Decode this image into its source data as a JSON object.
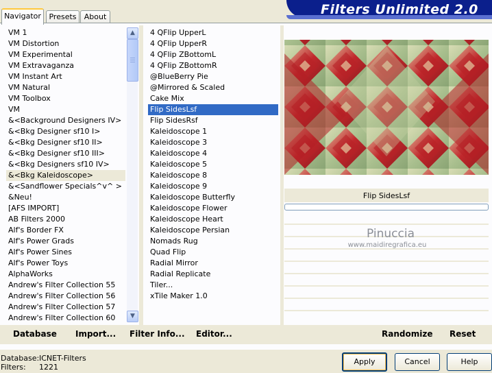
{
  "tabs": [
    "Navigator",
    "Presets",
    "About"
  ],
  "title": "Filters Unlimited 2.0",
  "categories": [
    "VM 1",
    "VM Distortion",
    "VM Experimental",
    "VM Extravaganza",
    "VM Instant Art",
    "VM Natural",
    "VM Toolbox",
    "VM",
    "&<Background Designers IV>",
    "&<Bkg Designer sf10 I>",
    "&<Bkg Designer sf10 II>",
    "&<Bkg Designer sf10 III>",
    "&<Bkg Designers sf10 IV>",
    "&<Bkg Kaleidoscope>",
    "&<Sandflower Specials^v^ >",
    "&Neu!",
    "[AFS IMPORT]",
    "AB Filters 2000",
    "Alf's Border FX",
    "Alf's Power Grads",
    "Alf's Power Sines",
    "Alf's Power Toys",
    "AlphaWorks",
    "Andrew's Filter Collection 55",
    "Andrew's Filter Collection 56",
    "Andrew's Filter Collection 57",
    "Andrew's Filter Collection 60"
  ],
  "selected_category": "&<Bkg Kaleidoscope>",
  "filters": [
    "4 QFlip UpperL",
    "4 QFlip UpperR",
    "4 QFlip ZBottomL",
    "4 QFlip ZBottomR",
    "@BlueBerry Pie",
    "@Mirrored & Scaled",
    "Cake Mix",
    "Flip SidesLsf",
    "Flip SidesRsf",
    "Kaleidoscope 1",
    "Kaleidoscope 3",
    "Kaleidoscope 4",
    "Kaleidoscope 5",
    "Kaleidoscope 8",
    "Kaleidoscope 9",
    "Kaleidoscope Butterfly",
    "Kaleidoscope Flower",
    "Kaleidoscope Heart",
    "Kaleidoscope Persian",
    "Nomads Rug",
    "Quad Flip",
    "Radial Mirror",
    "Radial Replicate",
    "Tiler...",
    "xTile Maker 1.0"
  ],
  "selected_filter": "Flip SidesLsf",
  "preview_filter_name": "Flip SidesLsf",
  "watermark": {
    "name": "Pinuccia",
    "url": "www.maidiregrafica.eu"
  },
  "toolbar": {
    "database": "Database",
    "import": "Import...",
    "filter_info": "Filter Info...",
    "editor": "Editor...",
    "randomize": "Randomize",
    "reset": "Reset"
  },
  "footer": {
    "database_label": "Database:",
    "database_value": "ICNET-Filters",
    "filters_label": "Filters:",
    "filters_value": "1221"
  },
  "buttons": {
    "apply": "Apply",
    "cancel": "Cancel",
    "help": "Help"
  },
  "colors": {
    "selection": "#316ac5",
    "banner": "#0b1f8c",
    "pattern_red": "#c0282c",
    "pattern_green": "#a9bf8e"
  }
}
